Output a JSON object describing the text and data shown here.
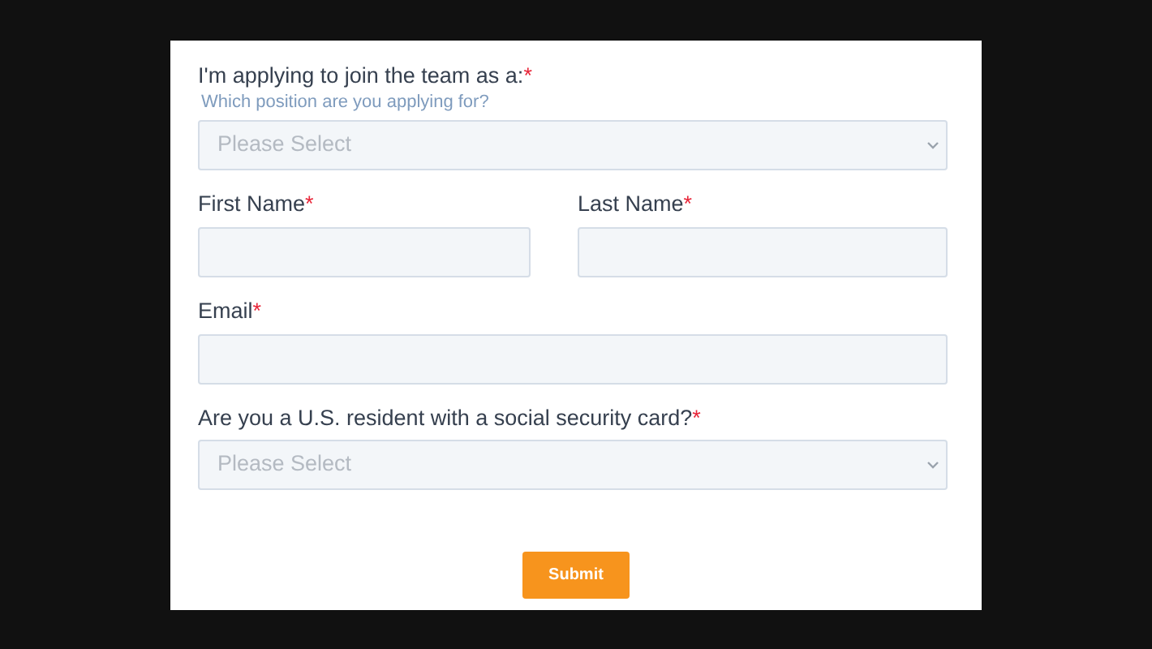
{
  "form": {
    "rows": [
      [
        {
          "kind": "select",
          "label": "I'm applying to join the team as a:",
          "required_mark": "*",
          "hint": "Which position are you applying for?",
          "placeholder": "Please Select"
        }
      ],
      [
        {
          "kind": "text",
          "label": "First Name",
          "required_mark": "*"
        },
        {
          "kind": "text",
          "label": "Last Name",
          "required_mark": "*"
        }
      ],
      [
        {
          "kind": "text",
          "label": "Email",
          "required_mark": "*"
        }
      ],
      [
        {
          "kind": "select",
          "label": "Are you a U.S. resident with a social security card?",
          "required_mark": "*",
          "placeholder": "Please Select"
        }
      ]
    ],
    "submit": "Submit"
  }
}
